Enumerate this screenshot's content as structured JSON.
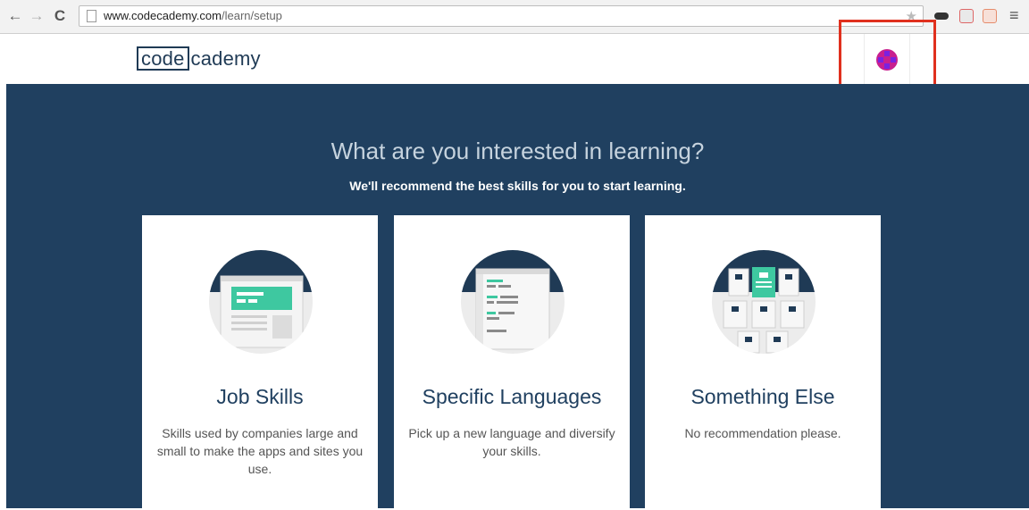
{
  "browser": {
    "url_domain": "www.codecademy.com",
    "url_path": "/learn/setup"
  },
  "header": {
    "logo_part1": "code",
    "logo_part2": "cademy"
  },
  "hero": {
    "title": "What are you interested in learning?",
    "subtitle": "We'll recommend the best skills for you to start learning."
  },
  "cards": [
    {
      "title": "Job Skills",
      "description": "Skills used by companies large and small to make the apps and sites you use."
    },
    {
      "title": "Specific Languages",
      "description": "Pick up a new language and diversify your skills."
    },
    {
      "title": "Something Else",
      "description": "No recommendation please."
    }
  ],
  "colors": {
    "hero_bg": "#204060",
    "accent_green": "#3ec8a0",
    "highlight_red": "#e0301e",
    "avatar": "#c81f8f"
  },
  "icons": [
    "back-icon",
    "forward-icon",
    "reload-icon",
    "star-icon",
    "menu-icon"
  ]
}
